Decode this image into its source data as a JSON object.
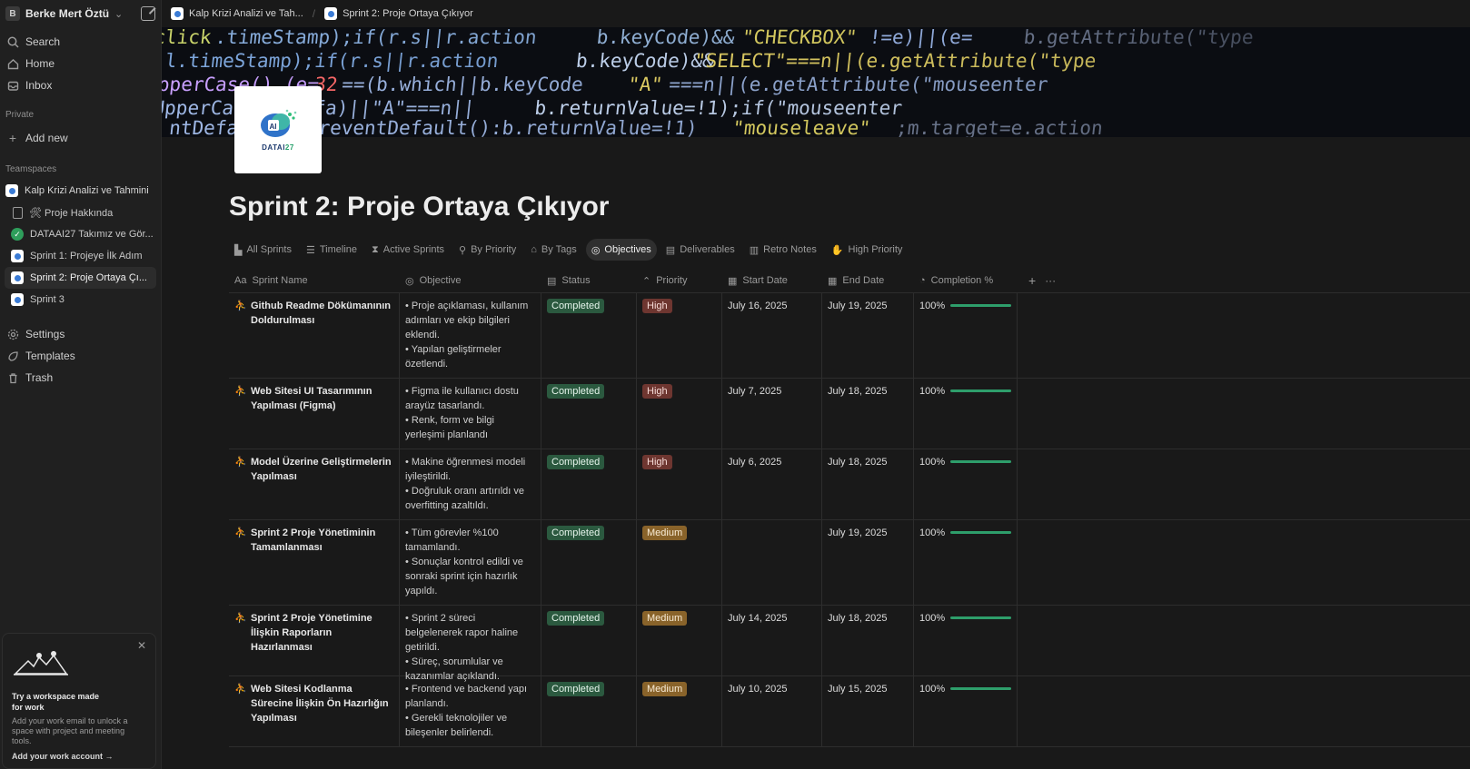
{
  "workspace": {
    "avatar": "B",
    "name": "Berke Mert Öztür..."
  },
  "sidebar": {
    "nav": [
      {
        "label": "Search",
        "icon": "search-icon"
      },
      {
        "label": "Home",
        "icon": "home-icon"
      },
      {
        "label": "Inbox",
        "icon": "inbox-icon"
      }
    ],
    "private_label": "Private",
    "add_new": "Add new",
    "teamspaces_label": "Teamspaces",
    "team": "Kalp Krizi Analizi ve Tahmini",
    "pages": [
      {
        "label": "🛠 Proje Hakkında",
        "icon": "doc-icon"
      },
      {
        "label": "DATAAI27 Takımız ve Gör...",
        "icon": "check-circle-icon"
      },
      {
        "label": "Sprint 1: Projeye İlk Adım",
        "icon": "page-logo-icon"
      },
      {
        "label": "Sprint 2: Proje Ortaya Çı...",
        "icon": "page-logo-icon"
      },
      {
        "label": "Sprint 3",
        "icon": "page-logo-icon"
      }
    ],
    "bottom": [
      {
        "label": "Settings",
        "icon": "gear-icon"
      },
      {
        "label": "Templates",
        "icon": "templates-icon"
      },
      {
        "label": "Trash",
        "icon": "trash-icon"
      }
    ],
    "promo": {
      "title": "Try a workspace made for work",
      "text": "Add your work email to unlock a space with project and meeting tools.",
      "link": "Add your work account →"
    }
  },
  "breadcrumbs": [
    "Kalp Krizi Analizi ve Tah...",
    "Sprint 2: Proje Ortaya Çıkıyor"
  ],
  "page": {
    "logo_text_main": "DATAI",
    "logo_text_accent": "27",
    "title": "Sprint 2: Proje Ortaya Çıkıyor"
  },
  "tabs": [
    {
      "label": "All Sprints",
      "icon": "▙"
    },
    {
      "label": "Timeline",
      "icon": "☰"
    },
    {
      "label": "Active Sprints",
      "icon": "⧗"
    },
    {
      "label": "By Priority",
      "icon": "⚲"
    },
    {
      "label": "By Tags",
      "icon": "⌂"
    },
    {
      "label": "Objectives",
      "icon": "◎",
      "active": true
    },
    {
      "label": "Deliverables",
      "icon": "▤"
    },
    {
      "label": "Retro Notes",
      "icon": "▥"
    },
    {
      "label": "High Priority",
      "icon": "✋"
    }
  ],
  "columns": [
    {
      "label": "Sprint Name",
      "icon": "Aa"
    },
    {
      "label": "Objective",
      "icon": "◎"
    },
    {
      "label": "Status",
      "icon": "▤"
    },
    {
      "label": "Priority",
      "icon": "⌃"
    },
    {
      "label": "Start Date",
      "icon": "▦"
    },
    {
      "label": "End Date",
      "icon": "▦"
    },
    {
      "label": "Completion %",
      "icon": "◔"
    }
  ],
  "rows": [
    {
      "name": "Github Readme Dökümanının Doldurulması",
      "objective": "• Proje açıklaması, kullanım adımları ve ekip bilgileri eklendi.\n• Yapılan geliştirmeler özetlendi.",
      "status": "Completed",
      "priority": "High",
      "start": "July 16, 2025",
      "end": "July 19, 2025",
      "completion": "100%",
      "completion_value": 1.0
    },
    {
      "name": "Web Sitesi UI Tasarımının Yapılması (Figma)",
      "objective": "• Figma ile kullanıcı dostu arayüz tasarlandı.\n• Renk, form ve bilgi yerleşimi planlandı",
      "status": "Completed",
      "priority": "High",
      "start": "July 7, 2025",
      "end": "July 18, 2025",
      "completion": "100%",
      "completion_value": 1.0
    },
    {
      "name": "Model Üzerine Geliştirmelerin Yapılması",
      "objective": "• Makine öğrenmesi modeli iyileştirildi.\n• Doğruluk oranı artırıldı ve overfitting azaltıldı.",
      "status": "Completed",
      "priority": "High",
      "start": "July 6, 2025",
      "end": "July 18, 2025",
      "completion": "100%",
      "completion_value": 1.0
    },
    {
      "name": "Sprint 2 Proje Yönetiminin Tamamlanması",
      "objective": "• Tüm görevler %100 tamamlandı.\n• Sonuçlar kontrol edildi ve sonraki sprint için hazırlık yapıldı.",
      "status": "Completed",
      "priority": "Medium",
      "start": "",
      "end": "July 19, 2025",
      "completion": "100%",
      "completion_value": 1.0
    },
    {
      "name": "Sprint 2 Proje Yönetimine İlişkin Raporların Hazırlanması",
      "objective": "• Sprint 2 süreci belgelenerek rapor haline getirildi.\n• Süreç, sorumlular ve kazanımlar açıklandı.",
      "status": "Completed",
      "priority": "Medium",
      "start": "July 14, 2025",
      "end": "July 18, 2025",
      "completion": "100%",
      "completion_value": 1.0
    },
    {
      "name": "Web Sitesi Kodlanma Sürecine İlişkin Ön Hazırlığın Yapılması",
      "objective": "• Frontend ve backend yapı planlandı.\n• Gerekli teknolojiler ve bileşenler belirlendi.",
      "status": "Completed",
      "priority": "Medium",
      "start": "July 10, 2025",
      "end": "July 15, 2025",
      "completion": "100%",
      "completion_value": 1.0
    }
  ],
  "colors": {
    "completed": "#2b593f",
    "high": "#6e3630",
    "medium": "#89632a",
    "progress": "#2e9e6b"
  }
}
